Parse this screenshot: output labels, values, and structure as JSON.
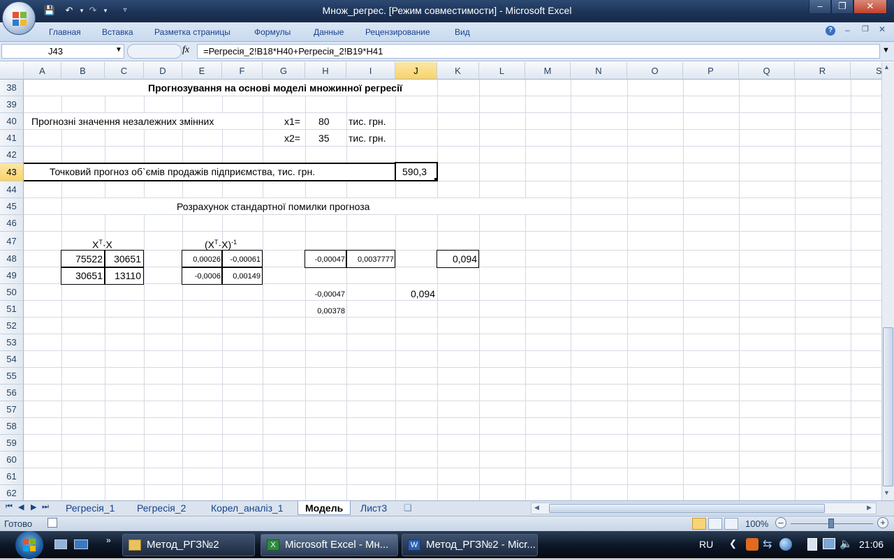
{
  "window": {
    "title": "Множ_регрес.  [Режим совместимости] - Microsoft Excel"
  },
  "ribbon": {
    "tabs": [
      "Главная",
      "Вставка",
      "Разметка страницы",
      "Формулы",
      "Данные",
      "Рецензирование",
      "Вид"
    ]
  },
  "formula_bar": {
    "name_box": "J43",
    "fx_label": "fx",
    "formula": "=Регресія_2!B18*H40+Регресія_2!B19*H41"
  },
  "columns": [
    "A",
    "B",
    "C",
    "D",
    "E",
    "F",
    "G",
    "H",
    "I",
    "J",
    "K",
    "L",
    "M",
    "N",
    "O",
    "P",
    "Q",
    "R",
    "S"
  ],
  "rows": [
    "38",
    "39",
    "40",
    "41",
    "42",
    "43",
    "44",
    "45",
    "46",
    "47",
    "48",
    "49",
    "50",
    "51",
    "52",
    "53",
    "54",
    "55",
    "56",
    "57",
    "58",
    "59",
    "60",
    "61",
    "62"
  ],
  "cells": {
    "title38": "Прогнозування на основі моделі множинної регресії",
    "label40": "Прогнозні значення незалежних змінних",
    "x1_label": "x1=",
    "x1_value": "80",
    "x1_unit": "тис. грн.",
    "x2_label": "x2=",
    "x2_value": "35",
    "x2_unit": "тис. грн.",
    "label43": "Точковий прогноз об`ємів продажів підприємства, тис. грн.",
    "value43": "590,3",
    "label45": "Розрахунок стандартної помилки прогноза",
    "xtx_pre": "X",
    "xtx_sup": "T",
    "xtx_post": "·X",
    "inv_pre": "(X",
    "inv_sup": "T",
    "inv_mid": "·X)",
    "inv_sup2": "-1",
    "B48": "75522",
    "C48": "30651",
    "B49": "30651",
    "C49": "13110",
    "E48": "0,00026",
    "F48": "-0,00061",
    "E49": "-0,0006",
    "F49": "0,00149",
    "H48": "-0,00047",
    "I48": "0,0037777",
    "K48": "0,094",
    "H50": "-0,00047",
    "J50": "0,094",
    "H51": "0,00378"
  },
  "sheet_tabs": [
    "Регресія_1",
    "Регресія_2",
    "Корел_аналіз_1",
    "Модель",
    "Лист3"
  ],
  "active_sheet": "Модель",
  "status": {
    "ready": "Готово",
    "zoom": "100%"
  },
  "taskbar": {
    "buttons": [
      "Метод_РГЗ№2",
      "Microsoft Excel - Мн...",
      "Метод_РГЗ№2 - Micr..."
    ],
    "lang": "RU",
    "clock": "21:06"
  }
}
